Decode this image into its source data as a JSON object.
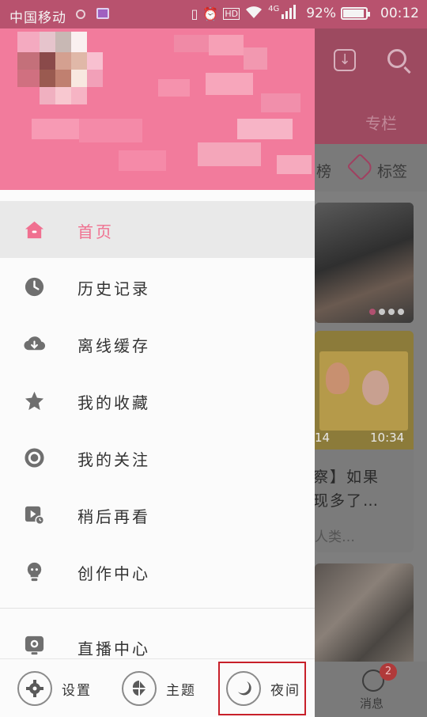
{
  "status_bar": {
    "carrier": "中国移动",
    "network": "4G",
    "battery_percent": "92%",
    "battery_level": 0.92,
    "time": "00:12"
  },
  "background_app": {
    "tab_partial": "专栏",
    "tag_partial": "榜",
    "tag_label": "标签",
    "card2_duration_left": "14",
    "card2_duration_right": "10:34",
    "card2_title_line1": "察】如果",
    "card2_title_line2": "现多了…",
    "card2_meta": "人类…",
    "message_badge": "2",
    "message_label": "消息"
  },
  "drawer": {
    "menu": [
      {
        "label": "首页",
        "icon": "home-icon",
        "active": true
      },
      {
        "label": "历史记录",
        "icon": "clock-icon",
        "active": false
      },
      {
        "label": "离线缓存",
        "icon": "cloud-download-icon",
        "active": false
      },
      {
        "label": "我的收藏",
        "icon": "star-icon",
        "active": false
      },
      {
        "label": "我的关注",
        "icon": "follow-icon",
        "active": false
      },
      {
        "label": "稍后再看",
        "icon": "watch-later-icon",
        "active": false
      },
      {
        "label": "创作中心",
        "icon": "lightbulb-icon",
        "active": false
      }
    ],
    "live_label": "直播中心",
    "bottom": {
      "settings": "设置",
      "theme": "主题",
      "night": "夜间"
    }
  },
  "colors": {
    "brand_pink": "#f27b9c",
    "active_text": "#f07090",
    "highlight_box": "#c8202a"
  }
}
